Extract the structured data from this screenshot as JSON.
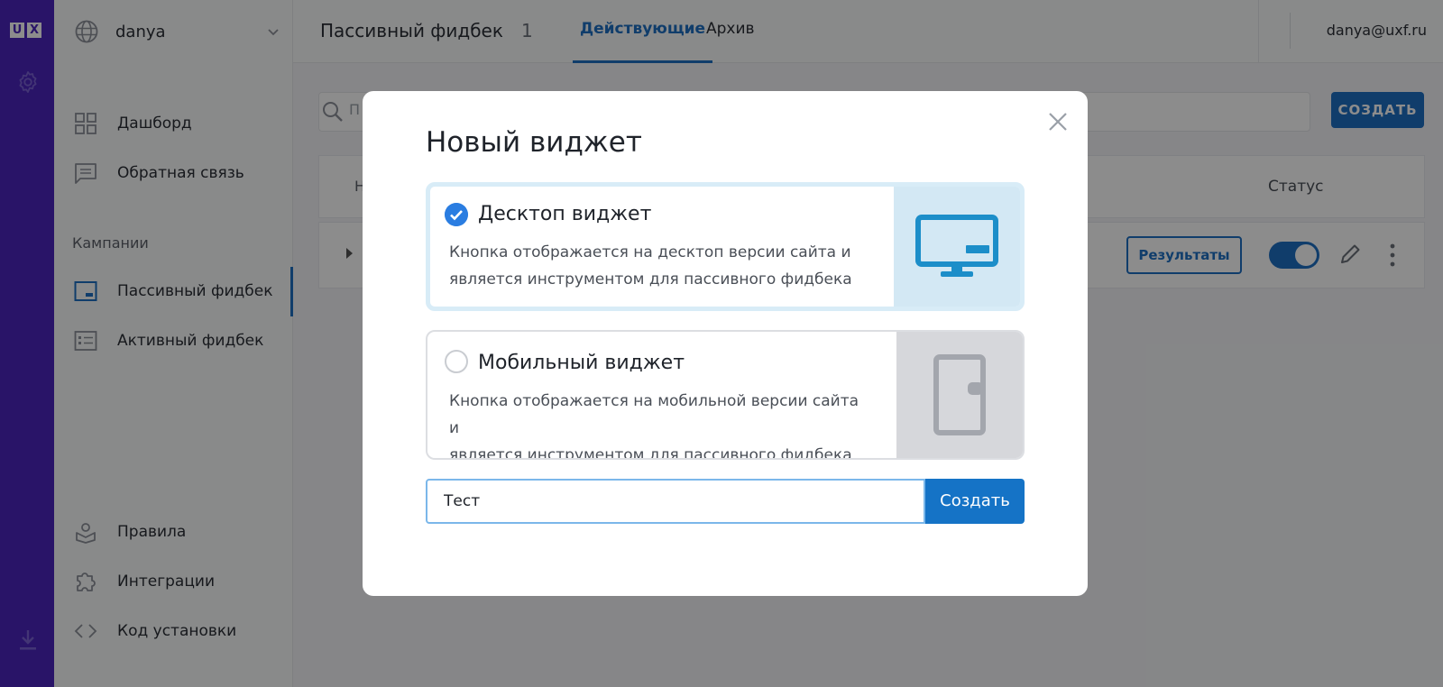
{
  "rail": {
    "logo_letters": [
      "U",
      "X"
    ],
    "icons": [
      "gear-icon",
      "download-icon"
    ]
  },
  "sidebar": {
    "account_name": "danya",
    "main_items": [
      {
        "label": "Дашборд",
        "icon": "dashboard-icon"
      },
      {
        "label": "Обратная связь",
        "icon": "feedback-icon"
      }
    ],
    "section_label": "Кампании",
    "campaign_items": [
      {
        "label": "Пассивный фидбек",
        "icon": "passive-feedback-icon",
        "active": true
      },
      {
        "label": "Активный фидбек",
        "icon": "active-feedback-icon",
        "active": false
      }
    ],
    "bottom_items": [
      {
        "label": "Правила",
        "icon": "rules-icon"
      },
      {
        "label": "Интеграции",
        "icon": "puzzle-icon"
      },
      {
        "label": "Код установки",
        "icon": "code-icon"
      }
    ]
  },
  "header": {
    "title": "Пассивный фидбек",
    "count": "1",
    "tabs": [
      {
        "label": "Действующие",
        "active": true
      },
      {
        "label": "Архив",
        "active": false
      }
    ],
    "user_email": "danya@uxf.ru"
  },
  "content": {
    "search_placeholder": "П",
    "create_button": "СОЗДАТЬ",
    "table_header_first": "Н",
    "status_column": "Статус",
    "row": {
      "results_button": "Результаты",
      "toggle_on": true
    }
  },
  "modal": {
    "title": "Новый виджет",
    "options": [
      {
        "title": "Десктоп виджет",
        "description_line1": "Кнопка отображается на десктоп версии сайта и",
        "description_line2": "является инструментом для пассивного фидбека",
        "selected": true,
        "icon": "monitor-icon"
      },
      {
        "title": "Мобильный виджет",
        "description_line1": "Кнопка отображается на мобильной версии сайта и",
        "description_line2": "является инструментом для пассивного фидбека",
        "selected": false,
        "icon": "phone-icon"
      }
    ],
    "name_input_value": "Тест",
    "create_label": "Создать"
  },
  "colors": {
    "rail": "#4b25bd",
    "accent": "#1e6fc4",
    "desktop_panel": "#d3e8f4",
    "mobile_panel": "#d6d7db"
  }
}
